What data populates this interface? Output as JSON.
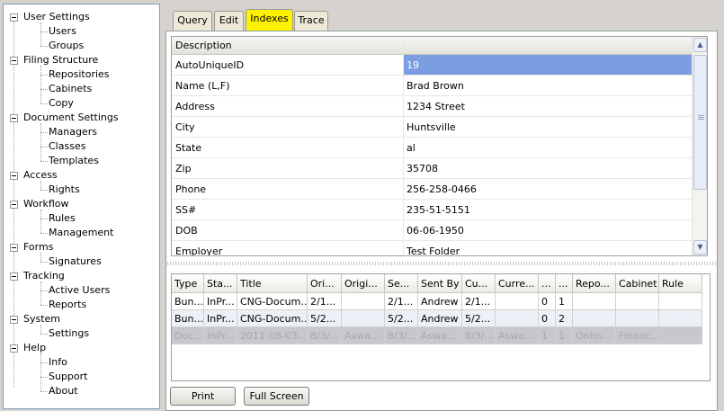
{
  "tree": [
    {
      "label": "User Settings",
      "children": [
        "Users",
        "Groups"
      ]
    },
    {
      "label": "Filing Structure",
      "children": [
        "Repositories",
        "Cabinets",
        "Copy"
      ]
    },
    {
      "label": "Document Settings",
      "children": [
        "Managers",
        "Classes",
        "Templates"
      ]
    },
    {
      "label": "Access",
      "children": [
        "Rights"
      ]
    },
    {
      "label": "Workflow",
      "children": [
        "Rules",
        "Management"
      ]
    },
    {
      "label": "Forms",
      "children": [
        "Signatures"
      ]
    },
    {
      "label": "Tracking",
      "children": [
        "Active Users",
        "Reports"
      ]
    },
    {
      "label": "System",
      "children": [
        "Settings"
      ]
    },
    {
      "label": "Help",
      "children": [
        "Info",
        "Support",
        "About"
      ]
    }
  ],
  "tabs": [
    "Query",
    "Edit",
    "Indexes",
    "Trace"
  ],
  "active_tab": "Indexes",
  "props": {
    "header": "Description",
    "rows": [
      {
        "k": "AutoUniqueID",
        "v": "19"
      },
      {
        "k": "Name (L,F)",
        "v": "Brad Brown"
      },
      {
        "k": "Address",
        "v": "1234 Street"
      },
      {
        "k": "City",
        "v": "Huntsville"
      },
      {
        "k": "State",
        "v": "al"
      },
      {
        "k": "Zip",
        "v": "35708"
      },
      {
        "k": "Phone",
        "v": "256-258-0466"
      },
      {
        "k": "SS#",
        "v": "235-51-5151"
      },
      {
        "k": "DOB",
        "v": "06-06-1950"
      },
      {
        "k": "Employer",
        "v": "Test Folder"
      }
    ]
  },
  "grid": {
    "columns": [
      "Type",
      "Sta...",
      "Title",
      "Ori...",
      "Origi...",
      "Se...",
      "Sent By",
      "Cu...",
      "Curre...",
      "...",
      "...",
      "Repo...",
      "Cabinet",
      "Rule"
    ],
    "rows": [
      [
        "Bun...",
        "InPr...",
        "CNG-Docum...",
        "2/1...",
        "",
        "2/1...",
        "Andrew",
        "2/1...",
        "",
        "0",
        "1",
        "",
        "",
        ""
      ],
      [
        "Bun...",
        "InPr...",
        "CNG-Docum...",
        "5/2...",
        "",
        "5/2...",
        "Andrew",
        "5/2...",
        "",
        "0",
        "2",
        "",
        "",
        ""
      ],
      [
        "Doc...",
        "InPr...",
        "2011-08-03...",
        "8/3/...",
        "Aswa...",
        "8/3/...",
        "Aswa...",
        "8/3/...",
        "Aswa...",
        "1",
        "1",
        "Onlin...",
        "Financ...",
        ""
      ]
    ]
  },
  "buttons": {
    "print": "Print",
    "fullscreen": "Full Screen"
  }
}
